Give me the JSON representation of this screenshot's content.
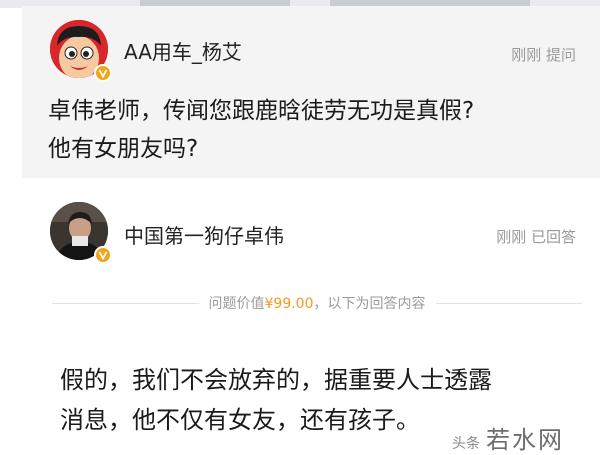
{
  "question": {
    "user_name": "AA用车_杨艾",
    "time": "刚刚",
    "status": "提问",
    "text_line1": "卓伟老师，传闻您跟鹿晗徒劳无功是真假?",
    "text_line2": "他有女朋友吗?"
  },
  "answer": {
    "user_name": "中国第一狗仔卓伟",
    "time": "刚刚",
    "status": "已回答",
    "price_prefix": "问题价值",
    "price_value": "¥99.00",
    "price_suffix": "，以下为回答内容",
    "text_line1": "假的，我们不会放弃的，据重要人士透露",
    "text_line2": "消息，他不仅有女友，还有孩子。"
  },
  "watermark": {
    "small_text": "头条",
    "brand_text": "若水网"
  },
  "colors": {
    "accent_price": "#f29b1e",
    "verified_badge": "#f2a516",
    "meta_text": "#9a9a9a",
    "question_bg": "#f4f4f4"
  },
  "icons": {
    "question_avatar": "cartoon-boy-avatar",
    "answer_avatar": "man-photo-avatar",
    "verified": "verified-v-badge-icon"
  }
}
